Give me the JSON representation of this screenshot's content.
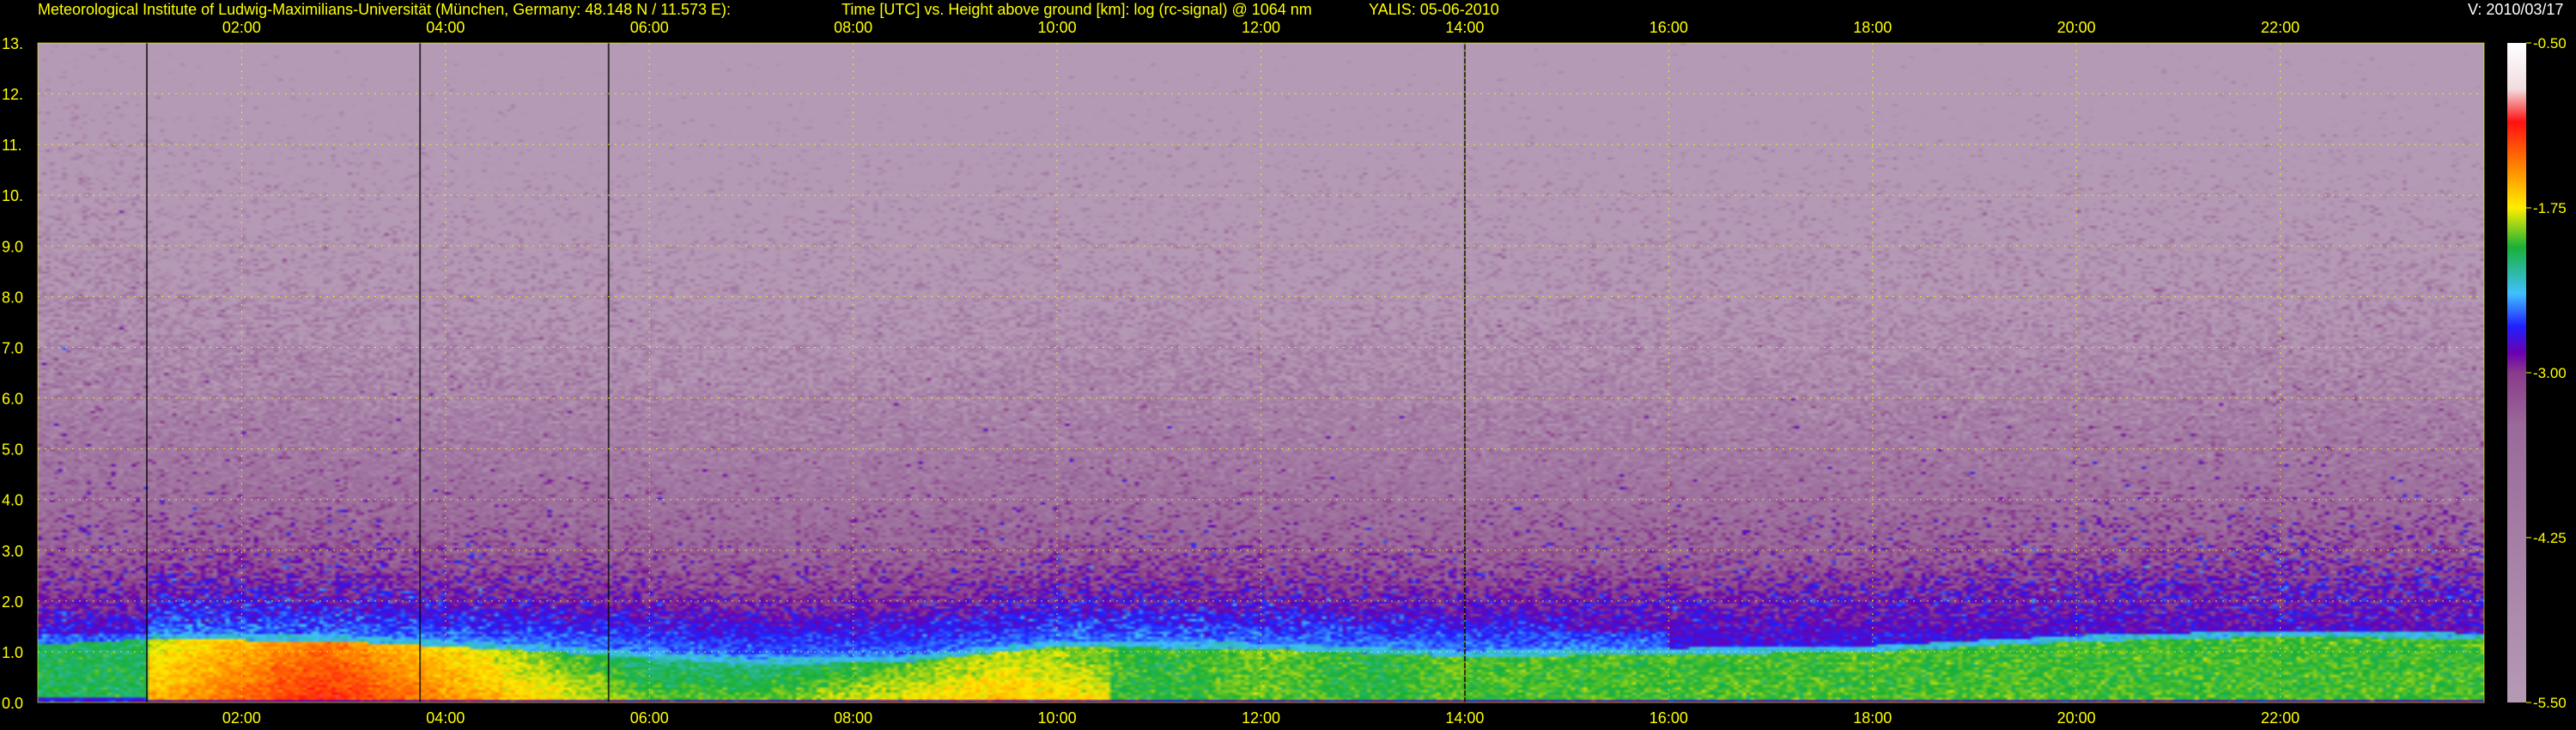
{
  "header": {
    "institute": "Meteorological Institute of Ludwig-Maximilians-Universität (München, Germany: 48.148 N / 11.573 E):",
    "plot_title": "Time [UTC] vs. Height above ground [km]: log (rc-signal) @ 1064 nm",
    "instrument_date": "YALIS: 05-06-2010",
    "version": "V: 2010/03/17"
  },
  "colors": {
    "title_text": "#ffff00",
    "version_text": "#ffffff",
    "grid": "#ffff00",
    "background": "#000000"
  },
  "chart_data": {
    "type": "heatmap",
    "title": "Time [UTC] vs. Height above ground [km]: log (rc-signal) @ 1064 nm",
    "xlabel": "",
    "ylabel": "",
    "x_unit": "hour UTC",
    "xlim": [
      0,
      24
    ],
    "ylim": [
      0,
      13
    ],
    "x_ticks": [
      "02:00",
      "04:00",
      "06:00",
      "08:00",
      "10:00",
      "12:00",
      "14:00",
      "16:00",
      "18:00",
      "20:00",
      "22:00"
    ],
    "x_tick_values": [
      2,
      4,
      6,
      8,
      10,
      12,
      14,
      16,
      18,
      20,
      22
    ],
    "y_ticks": [
      "0.0",
      "1.0",
      "2.0",
      "3.0",
      "4.0",
      "5.0",
      "6.0",
      "7.0",
      "8.0",
      "9.0",
      "10.",
      "11.",
      "12.",
      "13."
    ],
    "y_tick_values": [
      0,
      1,
      2,
      3,
      4,
      5,
      6,
      7,
      8,
      9,
      10,
      11,
      12,
      13
    ],
    "grid": true,
    "grid_style": "dotted",
    "vertical_markers_hour": [
      1.07,
      3.75,
      5.6,
      14.0
    ],
    "boundary_layer_top_km": [
      [
        0.1,
        1.15
      ],
      [
        1.1,
        1.25
      ],
      [
        3.0,
        1.2
      ],
      [
        5.0,
        1.0
      ],
      [
        7.0,
        0.75
      ],
      [
        8.5,
        0.8
      ],
      [
        10.0,
        1.1
      ],
      [
        12.0,
        1.05
      ],
      [
        14.0,
        0.9
      ],
      [
        16.0,
        0.95
      ],
      [
        18.0,
        1.0
      ],
      [
        20.0,
        1.2
      ],
      [
        22.0,
        1.3
      ],
      [
        23.9,
        1.25
      ]
    ],
    "colorbar": {
      "label": "log (rc-signal)",
      "range": [
        -5.5,
        -0.5
      ],
      "ticks": [
        "-0.50",
        "-1.75",
        "-3.00",
        "-4.25",
        "-5.50"
      ],
      "tick_values": [
        -0.5,
        -1.75,
        -3.0,
        -4.25,
        -5.5
      ],
      "stops": [
        [
          -0.5,
          "#ffffff"
        ],
        [
          -0.85,
          "#f0dde0"
        ],
        [
          -1.1,
          "#ff1010"
        ],
        [
          -1.45,
          "#ff8800"
        ],
        [
          -1.75,
          "#ffee00"
        ],
        [
          -2.05,
          "#18b038"
        ],
        [
          -2.4,
          "#40c0ff"
        ],
        [
          -2.65,
          "#2020ff"
        ],
        [
          -2.85,
          "#6a00b0"
        ],
        [
          -3.0,
          "#8a3a8a"
        ],
        [
          -3.4,
          "#9a6a9a"
        ],
        [
          -5.5,
          "#b59ab5"
        ]
      ]
    }
  }
}
